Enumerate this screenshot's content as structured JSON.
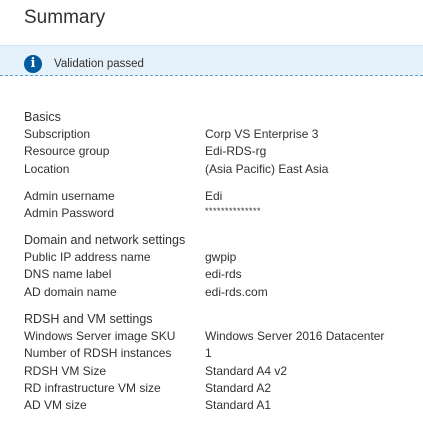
{
  "title": "Summary",
  "validation": {
    "icon": "info-icon",
    "message": "Validation passed",
    "color": "#005a9e"
  },
  "basics": {
    "heading": "Basics",
    "rows": [
      {
        "label": "Subscription",
        "value": "Corp VS Enterprise 3"
      },
      {
        "label": "Resource group",
        "value": "Edi-RDS-rg"
      },
      {
        "label": "Location",
        "value": "(Asia Pacific) East Asia"
      }
    ]
  },
  "admin": {
    "rows": [
      {
        "label": "Admin username",
        "value": "Edi"
      },
      {
        "label": "Admin Password",
        "value": "**************"
      }
    ]
  },
  "network": {
    "heading": "Domain and network settings",
    "rows": [
      {
        "label": "Public IP address name",
        "value": "gwpip"
      },
      {
        "label": "DNS name label",
        "value": "edi-rds"
      },
      {
        "label": "AD domain name",
        "value": "edi-rds.com"
      }
    ]
  },
  "vm": {
    "heading": "RDSH and VM settings",
    "rows": [
      {
        "label": "Windows Server image SKU",
        "value": "Windows Server 2016 Datacenter"
      },
      {
        "label": "Number of RDSH instances",
        "value": "1"
      },
      {
        "label": "RDSH VM Size",
        "value": "Standard A4 v2"
      },
      {
        "label": "RD infrastructure VM size",
        "value": "Standard A2"
      },
      {
        "label": "AD VM size",
        "value": "Standard A1"
      }
    ]
  }
}
